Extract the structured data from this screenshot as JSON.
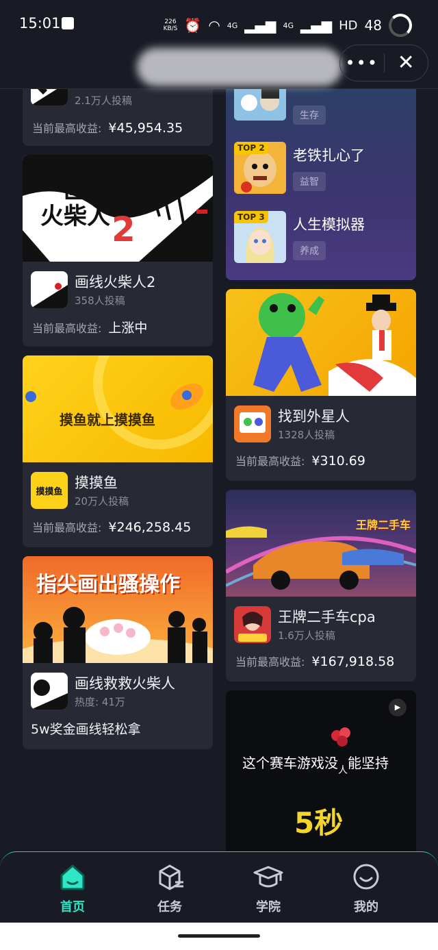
{
  "status": {
    "time": "15:01",
    "net_speed_top": "226",
    "net_speed_bottom": "KB/S",
    "signal1": "4G",
    "signal2": "4G",
    "hd": "HD",
    "battery": "48"
  },
  "topbar": {
    "more_label": "•••",
    "close_label": "✕"
  },
  "left_cards": [
    {
      "title": "",
      "sub": "2.1万人投稿",
      "earn_label": "当前最高收益:",
      "earn_value": "¥45,954.35"
    },
    {
      "title": "画线火柴人2",
      "sub": "358人投稿",
      "earn_label": "当前最高收益:",
      "earn_value": "上涨中",
      "thumb_text_1": "画线",
      "thumb_text_2": "火柴人",
      "thumb_text_3": "2"
    },
    {
      "title": "摸摸鱼",
      "sub": "20万人投稿",
      "earn_label": "当前最高收益:",
      "earn_value": "¥246,258.45",
      "thumb_text": "摸鱼就上摸摸鱼",
      "icon_text": "摸摸鱼"
    },
    {
      "title": "画线救救火柴人",
      "sub": "热度: 41万",
      "desc": "5w奖金画线轻松拿",
      "thumb_text": "指尖画出骚操作"
    }
  ],
  "ranking": [
    {
      "badge": "",
      "title": "",
      "tag": "生存"
    },
    {
      "badge": "TOP 2",
      "title": "老铁扎心了",
      "tag": "益智"
    },
    {
      "badge": "TOP 3",
      "title": "人生模拟器",
      "tag": "养成"
    }
  ],
  "right_cards": [
    {
      "title": "找到外星人",
      "sub": "1328人投稿",
      "earn_label": "当前最高收益:",
      "earn_value": "¥310.69"
    },
    {
      "title": "王牌二手车cpa",
      "sub": "1.6万人投稿",
      "earn_label": "当前最高收益:",
      "earn_value": "¥167,918.58",
      "thumb_text": "王牌二手车"
    }
  ],
  "ad": {
    "text_1": "这个赛车游戏没",
    "text_2": "人",
    "text_3": "能坚持",
    "big": "5秒",
    "play_icon": "▶"
  },
  "tabs": [
    {
      "label": "首页",
      "icon": "home-icon",
      "active": true
    },
    {
      "label": "任务",
      "icon": "box-icon",
      "active": false
    },
    {
      "label": "学院",
      "icon": "graduation-cap-icon",
      "active": false
    },
    {
      "label": "我的",
      "icon": "smile-face-icon",
      "active": false
    }
  ],
  "colors": {
    "accent": "#2ee6c6",
    "background": "#181b24",
    "card": "#272a35",
    "rank_badge": "#f7c600"
  }
}
